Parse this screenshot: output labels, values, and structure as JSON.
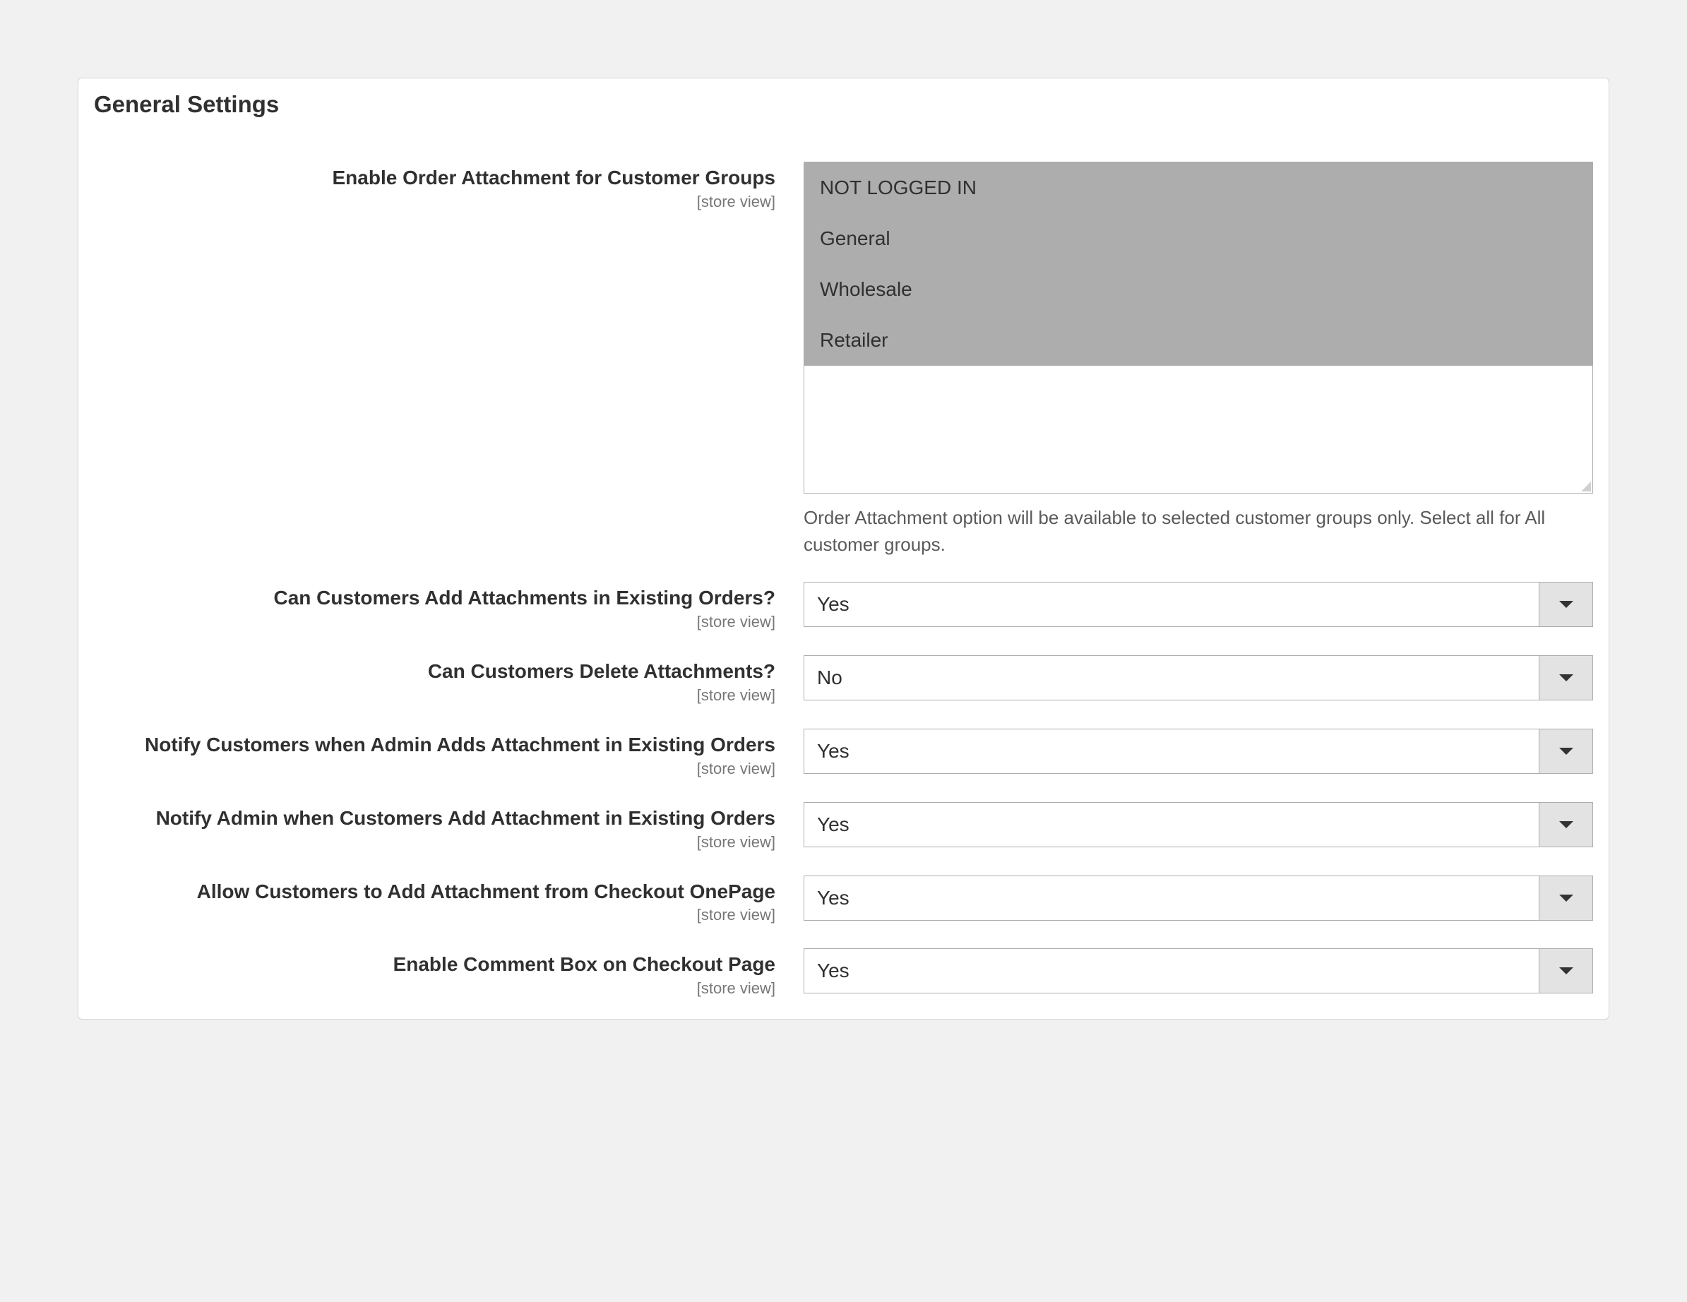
{
  "section_title": "General Settings",
  "scope_text": "[store view]",
  "fields": {
    "customer_groups": {
      "label": "Enable Order Attachment for Customer Groups",
      "options": [
        "NOT LOGGED IN",
        "General",
        "Wholesale",
        "Retailer"
      ],
      "note": "Order Attachment option will be available to selected customer groups only. Select all for All customer groups."
    },
    "add_existing": {
      "label": "Can Customers Add Attachments in Existing Orders?",
      "value": "Yes"
    },
    "delete_attachments": {
      "label": "Can Customers Delete Attachments?",
      "value": "No"
    },
    "notify_customers": {
      "label": "Notify Customers when Admin Adds Attachment in Existing Orders",
      "value": "Yes"
    },
    "notify_admin": {
      "label": "Notify Admin when Customers Add Attachment in Existing Orders",
      "value": "Yes"
    },
    "checkout_onepage": {
      "label": "Allow Customers to Add Attachment from Checkout OnePage",
      "value": "Yes"
    },
    "comment_box": {
      "label": "Enable Comment Box on Checkout Page",
      "value": "Yes"
    }
  }
}
